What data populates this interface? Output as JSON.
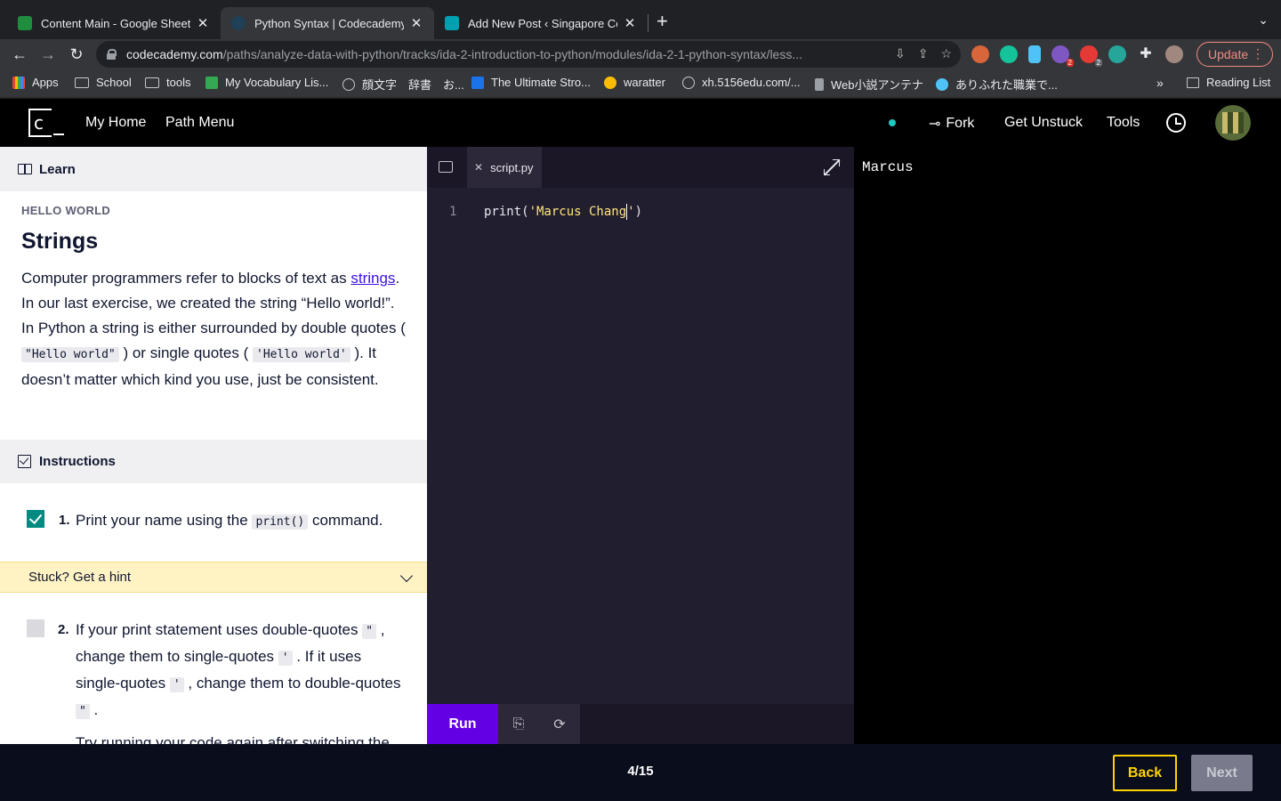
{
  "browser": {
    "tabs": [
      {
        "title": "Content Main - Google Sheets",
        "color": "#1e8e3e"
      },
      {
        "title": "Python Syntax | Codecademy",
        "color": "#1f4056"
      },
      {
        "title": "Add New Post ‹ Singapore Cod",
        "color": "#00a0b0"
      }
    ],
    "url_host": "codecademy.com",
    "url_path": "/paths/analyze-data-with-python/tracks/ida-2-introduction-to-python/modules/ida-2-1-python-syntax/less...",
    "update_label": "Update",
    "extension_badges": [
      "2",
      "2"
    ],
    "bookmarks": [
      {
        "label": "Apps",
        "icon": "apps-grid-icon"
      },
      {
        "label": "School",
        "icon": "folder-icon"
      },
      {
        "label": "tools",
        "icon": "folder-icon"
      },
      {
        "label": "My Vocabulary Lis...",
        "icon": "vocab-icon"
      },
      {
        "label": "顔文字　辞書　お...",
        "icon": "globe-icon"
      },
      {
        "label": "The Ultimate Stro...",
        "icon": "jj-icon"
      },
      {
        "label": "waratter",
        "icon": "star-icon"
      },
      {
        "label": "xh.5156edu.com/...",
        "icon": "globe-icon"
      },
      {
        "label": "Web小説アンテナ",
        "icon": "bookmark-icon"
      },
      {
        "label": "ありふれた職業で...",
        "icon": "wp-icon"
      }
    ],
    "reading_list": "Reading List",
    "more": "»"
  },
  "header": {
    "logo_letter": "c",
    "my_home": "My Home",
    "path_menu": "Path Menu",
    "fork": "Fork",
    "get_unstuck": "Get Unstuck",
    "tools": "Tools"
  },
  "learn": {
    "panel_title": "Learn",
    "kicker": "HELLO WORLD",
    "title": "Strings",
    "p1": "Computer programmers refer to blocks of text as ",
    "link": "strings",
    "p2": ". In our last exercise, we created the string “Hello world!”. In Python a string is either surrounded by double quotes ( ",
    "code1": "\"Hello world\"",
    "p3": " ) or single quotes ( ",
    "code2": "'Hello world'",
    "p4": " ). It doesn’t matter which kind you use, just be consistent.",
    "instructions_title": "Instructions",
    "task1_num": "1.",
    "task1_a": "Print your name using the ",
    "task1_code": "print()",
    "task1_b": " command.",
    "hint": "Stuck? Get a hint",
    "task2_num": "2.",
    "task2_a": "If your print statement uses double-quotes ",
    "task2_q1": "\"",
    "task2_b": " , change them to single-quotes ",
    "task2_q2": "'",
    "task2_c": " . If it uses single-quotes ",
    "task2_q3": "'",
    "task2_d": " , change them to double-quotes ",
    "task2_q4": "\"",
    "task2_e": " .",
    "cut_text": "Try running your code again after switching the"
  },
  "editor": {
    "file_name": "script.py",
    "line_number": "1",
    "code_prefix": "print(",
    "code_string": "'Marcus Chang",
    "code_string_end": "'",
    "code_suffix": ")",
    "run": "Run"
  },
  "output": {
    "text": "Marcus"
  },
  "footer": {
    "progress": "4/15",
    "back": "Back",
    "next": "Next"
  }
}
